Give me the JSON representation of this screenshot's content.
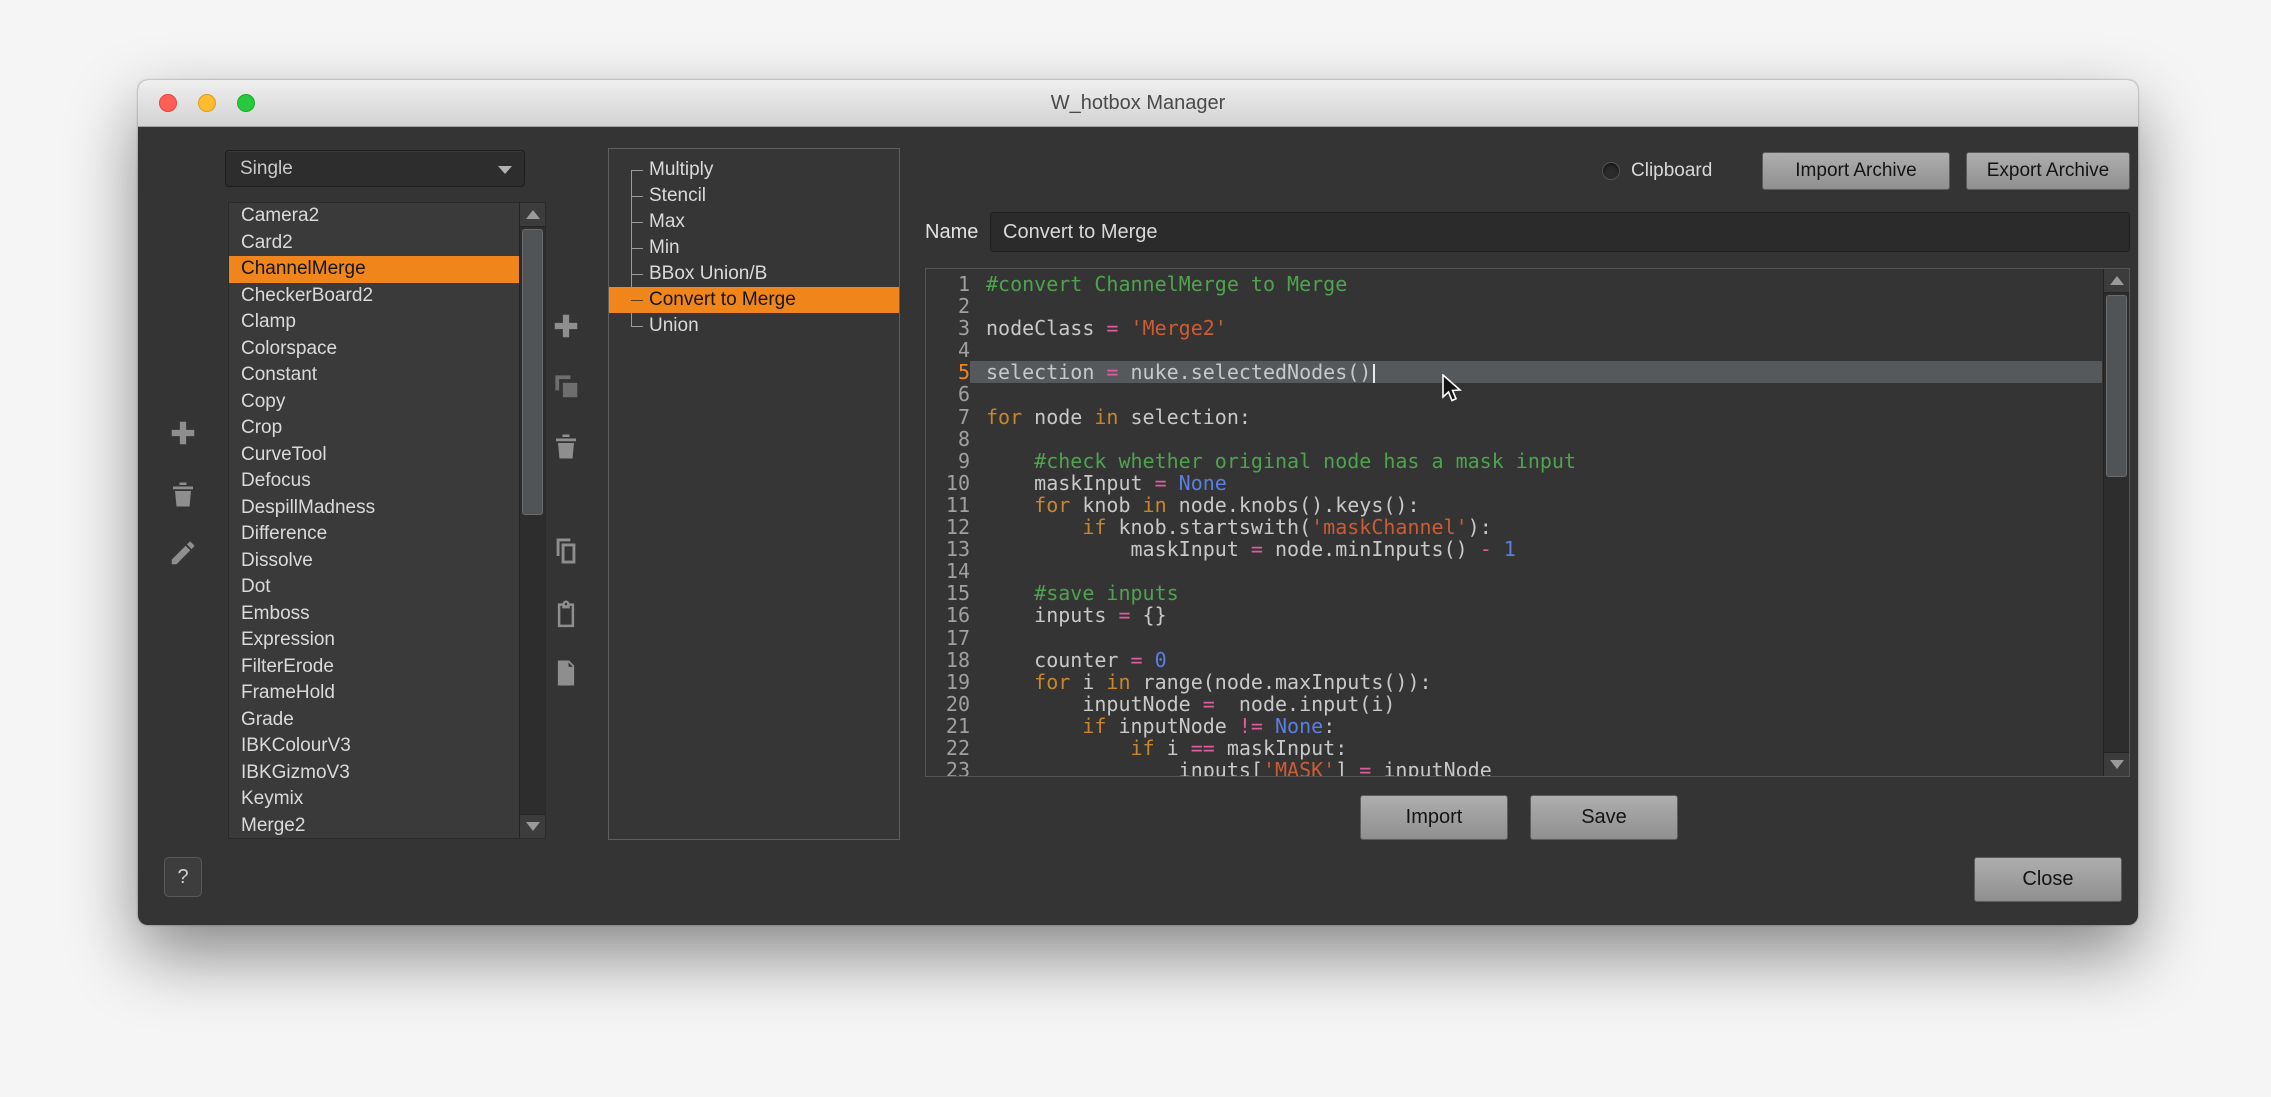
{
  "titlebar": {
    "title": "W_hotbox Manager"
  },
  "left": {
    "mode": "Single",
    "items": [
      "Camera2",
      "Card2",
      "ChannelMerge",
      "CheckerBoard2",
      "Clamp",
      "Colorspace",
      "Constant",
      "Copy",
      "Crop",
      "CurveTool",
      "Defocus",
      "DespillMadness",
      "Difference",
      "Dissolve",
      "Dot",
      "Emboss",
      "Expression",
      "FilterErode",
      "FrameHold",
      "Grade",
      "IBKColourV3",
      "IBKGizmoV3",
      "Keymix",
      "Merge2"
    ],
    "selected_index": 2,
    "help_label": "?"
  },
  "left_toolbar": {
    "icons": [
      "add",
      "delete",
      "edit"
    ]
  },
  "middle_toolbar": {
    "icons": [
      "add",
      "add-submenu",
      "delete",
      "copy",
      "paste",
      "edit-script"
    ]
  },
  "tree": {
    "items": [
      "Multiply",
      "Stencil",
      "Max",
      "Min",
      "BBox Union/B",
      "Convert to Merge",
      "Union"
    ],
    "selected_index": 5
  },
  "topbar": {
    "clipboard_label": "Clipboard",
    "import_archive": "Import Archive",
    "export_archive": "Export Archive"
  },
  "name_row": {
    "label": "Name",
    "value": "Convert to Merge"
  },
  "actions": {
    "import": "Import",
    "save": "Save",
    "close": "Close"
  },
  "colors": {
    "selection_orange": "#f0851b",
    "comment_green": "#4fa34f",
    "keyword_orange": "#c8862b",
    "string_red": "#cc5c33",
    "number_blue": "#5b7fe0",
    "operator_pink": "#e05d9d",
    "current_line_bg": "#56595c"
  },
  "editor": {
    "current_line": 5,
    "lines": [
      [
        [
          "c",
          "#convert ChannelMerge to Merge"
        ]
      ],
      [],
      [
        [
          "p",
          "nodeClass "
        ],
        [
          "o",
          "="
        ],
        [
          "p",
          " "
        ],
        [
          "s",
          "'Merge2'"
        ]
      ],
      [],
      [
        [
          "p",
          "selection "
        ],
        [
          "o",
          "="
        ],
        [
          "p",
          " nuke.selectedNodes()"
        ]
      ],
      [],
      [
        [
          "k",
          "for"
        ],
        [
          "p",
          " node "
        ],
        [
          "k",
          "in"
        ],
        [
          "p",
          " selection:"
        ]
      ],
      [],
      [
        [
          "c",
          "    #check whether original node has a mask input"
        ]
      ],
      [
        [
          "p",
          "    maskInput "
        ],
        [
          "o",
          "="
        ],
        [
          "p",
          " "
        ],
        [
          "n",
          "None"
        ]
      ],
      [
        [
          "p",
          "    "
        ],
        [
          "k",
          "for"
        ],
        [
          "p",
          " knob "
        ],
        [
          "k",
          "in"
        ],
        [
          "p",
          " node.knobs().keys():"
        ]
      ],
      [
        [
          "p",
          "        "
        ],
        [
          "k",
          "if"
        ],
        [
          "p",
          " knob.startswith("
        ],
        [
          "s",
          "'maskChannel'"
        ],
        [
          "p",
          "):"
        ]
      ],
      [
        [
          "p",
          "            maskInput "
        ],
        [
          "o",
          "="
        ],
        [
          "p",
          " node.minInputs() "
        ],
        [
          "o",
          "-"
        ],
        [
          "p",
          " "
        ],
        [
          "n",
          "1"
        ]
      ],
      [],
      [
        [
          "c",
          "    #save inputs"
        ]
      ],
      [
        [
          "p",
          "    inputs "
        ],
        [
          "o",
          "="
        ],
        [
          "p",
          " {}"
        ]
      ],
      [],
      [
        [
          "p",
          "    counter "
        ],
        [
          "o",
          "="
        ],
        [
          "p",
          " "
        ],
        [
          "n",
          "0"
        ]
      ],
      [
        [
          "p",
          "    "
        ],
        [
          "k",
          "for"
        ],
        [
          "p",
          " i "
        ],
        [
          "k",
          "in"
        ],
        [
          "p",
          " range(node.maxInputs()):"
        ]
      ],
      [
        [
          "p",
          "        inputNode "
        ],
        [
          "o",
          "="
        ],
        [
          "p",
          "  node.input(i)"
        ]
      ],
      [
        [
          "p",
          "        "
        ],
        [
          "k",
          "if"
        ],
        [
          "p",
          " inputNode "
        ],
        [
          "o",
          "!="
        ],
        [
          "p",
          " "
        ],
        [
          "n",
          "None"
        ],
        [
          "p",
          ":"
        ]
      ],
      [
        [
          "p",
          "            "
        ],
        [
          "k",
          "if"
        ],
        [
          "p",
          " i "
        ],
        [
          "o",
          "=="
        ],
        [
          "p",
          " maskInput:"
        ]
      ],
      [
        [
          "p",
          "                inputs["
        ],
        [
          "s",
          "'MASK'"
        ],
        [
          "p",
          "] "
        ],
        [
          "o",
          "="
        ],
        [
          "p",
          " inputNode"
        ]
      ]
    ]
  }
}
